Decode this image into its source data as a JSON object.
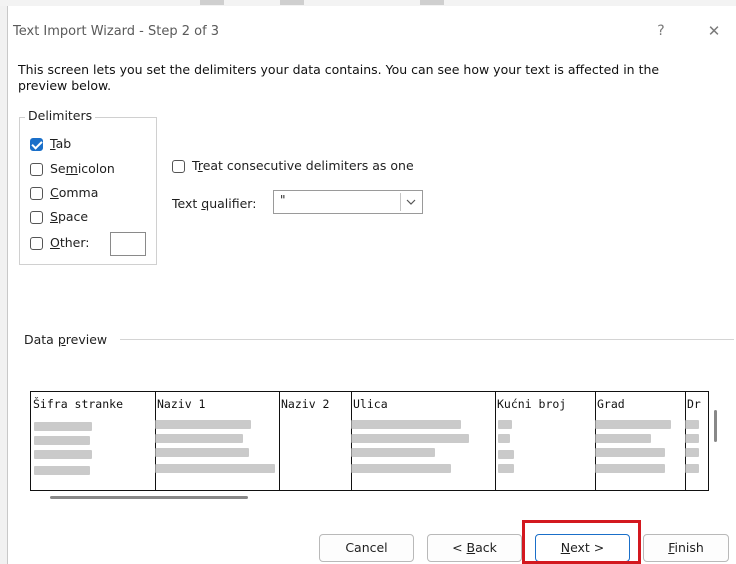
{
  "window": {
    "title": "Text Import Wizard - Step 2 of 3",
    "help_glyph": "?",
    "close_glyph": "✕"
  },
  "description": "This screen lets you set the delimiters your data contains.  You can see how your text is affected in the preview below.",
  "delimiters": {
    "group_title": "Delimiters",
    "items": [
      {
        "label_pre": "",
        "label_u": "T",
        "label_post": "ab",
        "checked": true
      },
      {
        "label_pre": "Se",
        "label_u": "m",
        "label_post": "icolon",
        "checked": false
      },
      {
        "label_pre": "",
        "label_u": "C",
        "label_post": "omma",
        "checked": false
      },
      {
        "label_pre": "",
        "label_u": "S",
        "label_post": "pace",
        "checked": false
      },
      {
        "label_pre": "",
        "label_u": "O",
        "label_post": "ther:",
        "checked": false
      }
    ]
  },
  "consecutive": {
    "label_pre": "T",
    "label_u": "r",
    "label_post": "eat consecutive delimiters as one",
    "checked": false
  },
  "text_qualifier": {
    "label_pre": "Text ",
    "label_u": "q",
    "label_post": "ualifier:",
    "value": "\""
  },
  "preview": {
    "title_pre": "Data ",
    "title_u": "p",
    "title_post": "review",
    "columns": [
      "Šifra stranke",
      "Naziv 1",
      "Naziv 2",
      "Ulica",
      "Kućni broj",
      "Grad",
      "Dr"
    ]
  },
  "buttons": {
    "cancel": "Cancel",
    "back_pre": "< ",
    "back_u": "B",
    "back_post": "ack",
    "next_u": "N",
    "next_post": "ext >",
    "finish_u": "F",
    "finish_post": "inish"
  },
  "colors": {
    "accent": "#1a6fc9",
    "highlight": "#d3181f"
  }
}
